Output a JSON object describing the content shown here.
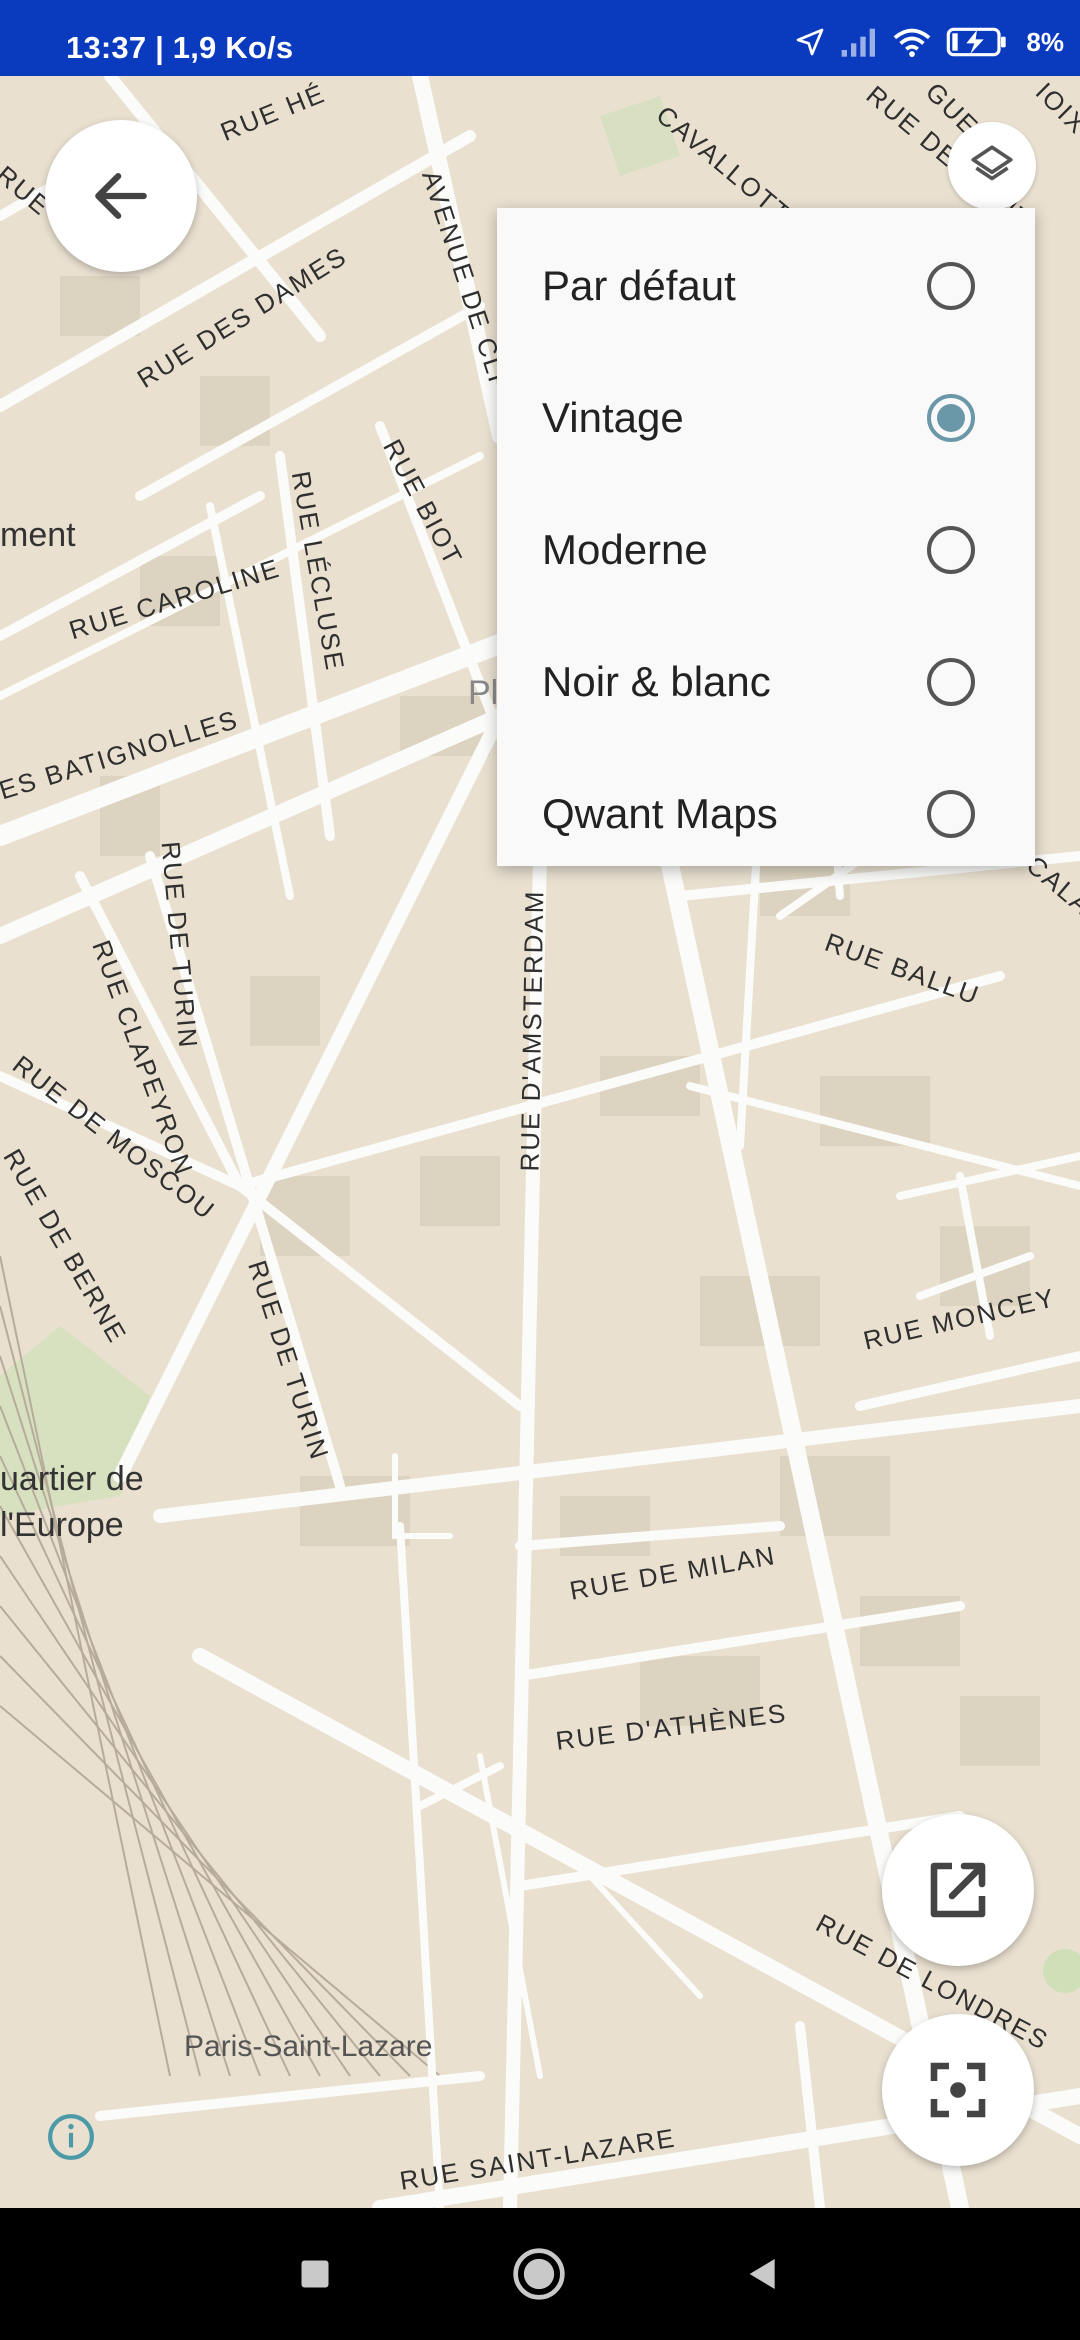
{
  "status_bar": {
    "time_speed": "13:37 | 1,9 Ko/s",
    "battery": "8%",
    "icons": [
      "location-arrow-icon",
      "signal-icon",
      "wifi-icon",
      "battery-charging-icon"
    ]
  },
  "map": {
    "street_labels": [
      "RUE HÉ",
      "AVENUE DE CLI",
      "CAVALLOTTI",
      "RUE DE SAINT",
      "GUER",
      "IOIX",
      "RUE",
      "RUE DES DAMES",
      "RUE LÉCLUSE",
      "RUE BIOT",
      "ment",
      "RUE CAROLINE",
      "Pla",
      "ES BATIGNOLLES",
      "RUE DE TURIN",
      "RUE CLAPEYRON",
      "RUE D'AMSTERDAM",
      "RUE BALLU",
      "CALA",
      "RUE DE MOSCOU",
      "RUE DE BERNE",
      "RUE DE TURIN",
      "RUE MONCEY",
      "uartier de",
      "l'Europe",
      "RUE DE MILAN",
      "RUE D'ATHÈNES",
      "RUE DE LONDRES",
      "Paris-Saint-Lazare",
      "RUE SAINT-LAZARE"
    ],
    "colors": {
      "land": "#e9e0d0",
      "road": "#fbfbf9",
      "park": "#cfe0b8"
    }
  },
  "layer_menu": {
    "options": [
      {
        "label": "Par défaut",
        "selected": false
      },
      {
        "label": "Vintage",
        "selected": true
      },
      {
        "label": "Moderne",
        "selected": false
      },
      {
        "label": "Noir & blanc",
        "selected": false
      },
      {
        "label": "Qwant Maps",
        "selected": false
      }
    ],
    "accent": "#6b98a8"
  },
  "buttons": {
    "back": "arrow-left-icon",
    "layers": "layers-icon",
    "open_external": "open-external-icon",
    "center": "center-focus-icon",
    "info": "info-icon"
  },
  "nav_bar": [
    "recent-apps-icon",
    "home-icon",
    "back-triangle-icon"
  ]
}
